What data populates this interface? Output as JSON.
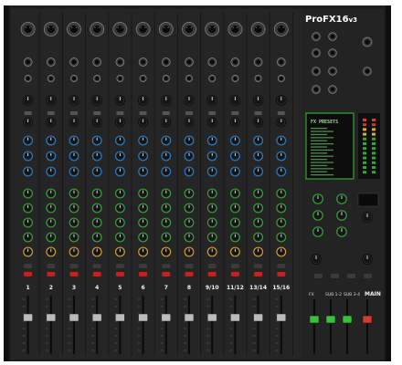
{
  "brand": {
    "name": "ProFX16v3",
    "name_pro": "Pro",
    "name_model": "FX16",
    "name_version": "v3"
  },
  "fx_presets": {
    "title": "FX PRESETS"
  },
  "channels": [
    {
      "label": "1"
    },
    {
      "label": "2"
    },
    {
      "label": "3"
    },
    {
      "label": "4"
    },
    {
      "label": "5"
    },
    {
      "label": "6"
    },
    {
      "label": "7"
    },
    {
      "label": "8"
    },
    {
      "label": "9/10"
    },
    {
      "label": "11/12"
    },
    {
      "label": "13/14"
    },
    {
      "label": "15/16"
    }
  ],
  "master_section": {
    "bus_labels": [
      "FX",
      "SUB 1-2",
      "SUB 3-4"
    ],
    "main_label": "MAIN"
  },
  "colors": {
    "chassis": "#1b1b1b",
    "panel": "#262626",
    "knob_black": "#111111",
    "accent_blue": "#1e7fd6",
    "accent_green": "#2fa83a",
    "accent_yellow": "#e0a820",
    "button_red": "#c9201e",
    "mackie_green": "#35c23a"
  }
}
